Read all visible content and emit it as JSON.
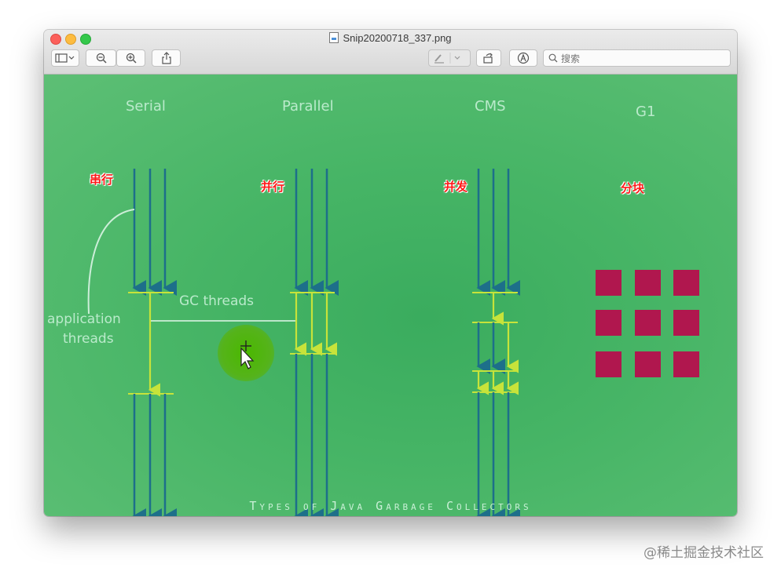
{
  "window": {
    "title": "Snip20200718_337.png"
  },
  "toolbar": {
    "search_placeholder": "搜索",
    "sidebar_button": "sidebar-toggle-icon",
    "zoom_out": "zoom-out-icon",
    "zoom_in": "zoom-in-icon",
    "share": "share-icon",
    "markup": "pen-icon",
    "rotate": "rotate-icon",
    "annotate": "markup-circle-icon"
  },
  "image": {
    "columns": [
      {
        "en": "Serial",
        "zh": "串行"
      },
      {
        "en": "Parallel",
        "zh": "并行"
      },
      {
        "en": "CMS",
        "zh": "并发"
      },
      {
        "en": "G1",
        "zh": "分块"
      }
    ],
    "annotations": {
      "application_threads_line1": "application",
      "application_threads_line2": "threads",
      "gc_threads": "GC threads"
    },
    "caption": "Types of Java Garbage Collectors",
    "colors": {
      "background": "#4cb86a",
      "thread_arrow": "#1d6f8a",
      "gc_arrow": "#c7e33a",
      "g1_block": "#b0174e"
    }
  },
  "watermark": "@稀土掘金技术社区"
}
